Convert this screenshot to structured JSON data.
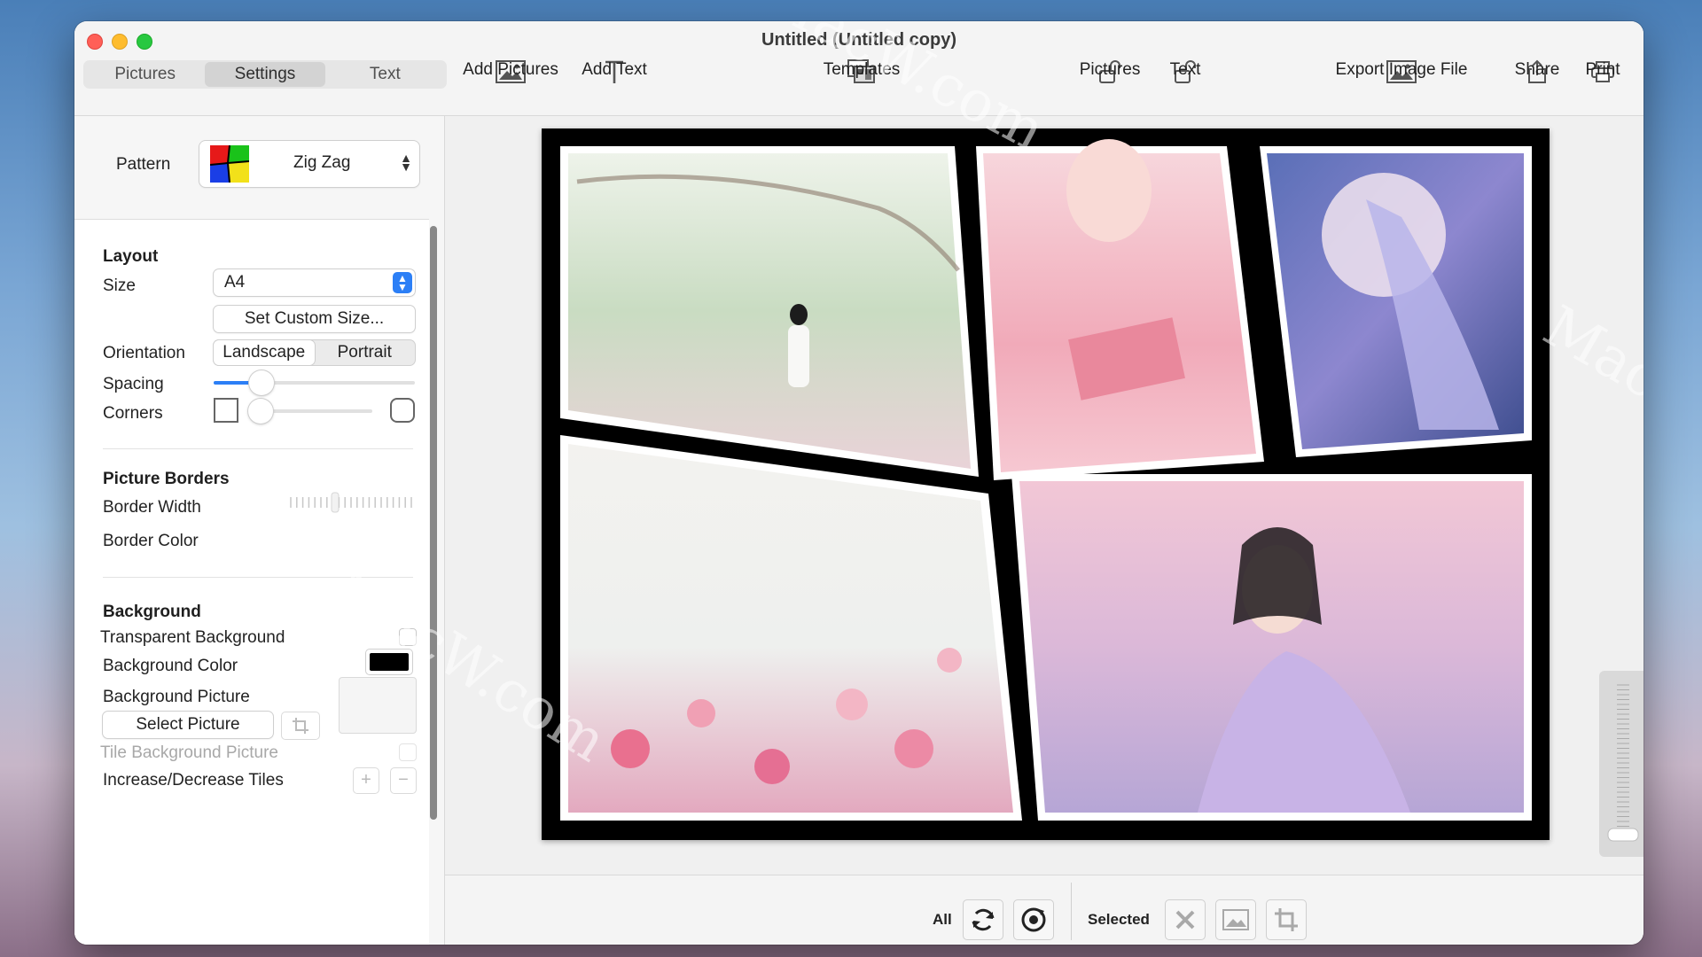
{
  "window": {
    "title": "Untitled (Untitled copy)"
  },
  "tabs": [
    {
      "label": "Pictures"
    },
    {
      "label": "Settings"
    },
    {
      "label": "Text"
    }
  ],
  "toolbar": {
    "add_pictures": "Add Pictures",
    "add_text": "Add Text",
    "templates": "Templates",
    "pictures": "Pictures",
    "text": "Text",
    "export": "Export Image File",
    "share": "Share",
    "print": "Print"
  },
  "pattern": {
    "label": "Pattern",
    "value": "Zig Zag"
  },
  "layout": {
    "title": "Layout",
    "size_label": "Size",
    "size_value": "A4",
    "custom_size_button": "Set Custom Size...",
    "orientation_label": "Orientation",
    "orientation_options": [
      "Landscape",
      "Portrait"
    ],
    "orientation_selected": "Landscape",
    "spacing_label": "Spacing",
    "spacing_value": 0.2,
    "corners_label": "Corners",
    "corners_value": 0.0
  },
  "picture_borders": {
    "title": "Picture Borders",
    "border_width_label": "Border Width",
    "border_color_label": "Border Color"
  },
  "background": {
    "title": "Background",
    "transparent_label": "Transparent Background",
    "transparent_checked": false,
    "color_label": "Background Color",
    "color_value": "#000000",
    "picture_label": "Background Picture",
    "select_picture_button": "Select Picture",
    "tile_label": "Tile Background Picture",
    "tiles_label": "Increase/Decrease Tiles"
  },
  "bottom": {
    "all_label": "All",
    "selected_label": "Selected"
  },
  "watermark": "MacW.com",
  "colors": {
    "accent": "#2c7ff6",
    "canvas_bg": "#000000"
  }
}
